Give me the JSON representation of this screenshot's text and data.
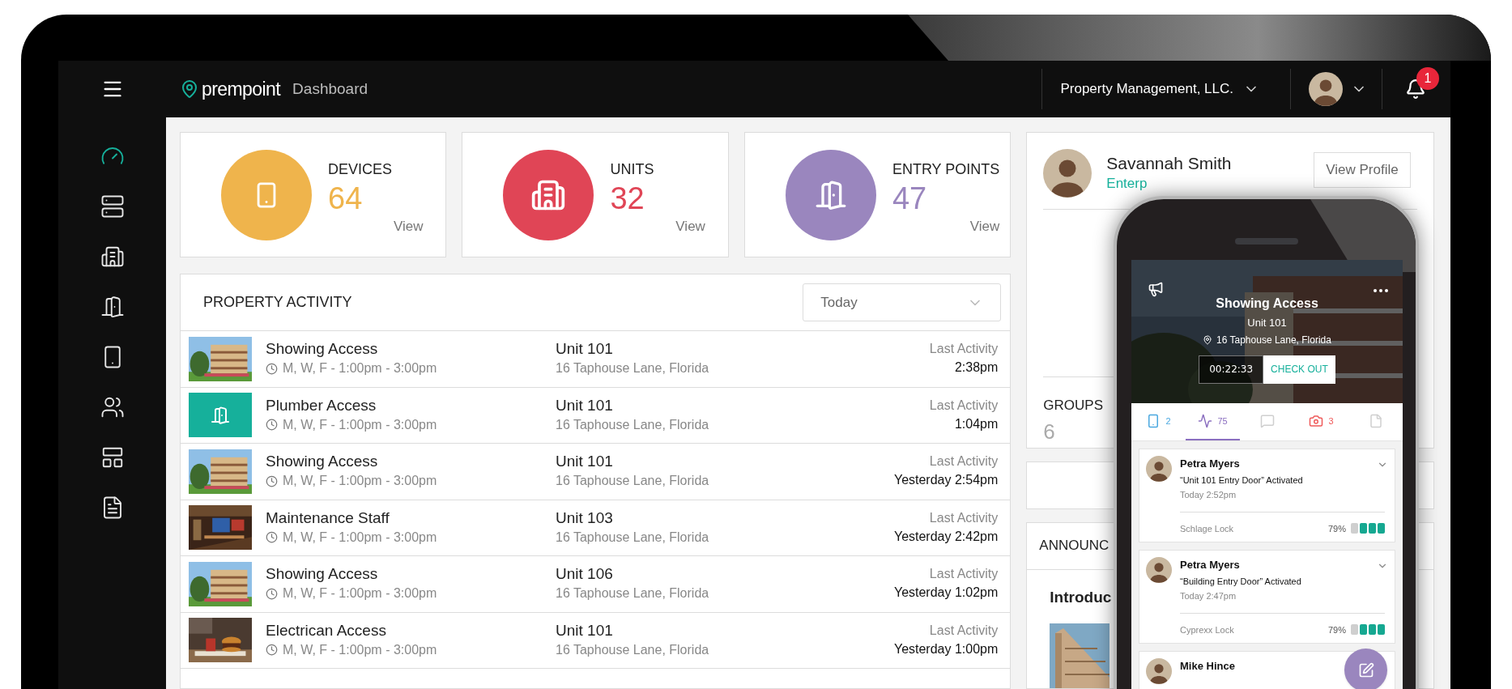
{
  "brand": {
    "logo": "prempoint",
    "page": "Dashboard"
  },
  "account": {
    "organization": "Property Management, LLC."
  },
  "notifications": {
    "count": "1"
  },
  "sidebar": {
    "items": [
      {
        "selected": true
      },
      {
        "selected": false
      },
      {
        "selected": false
      },
      {
        "selected": false
      },
      {
        "selected": false
      },
      {
        "selected": false
      },
      {
        "selected": false
      },
      {
        "selected": false
      }
    ]
  },
  "stats": [
    {
      "label": "DEVICES",
      "value": "64",
      "link": "View",
      "color": "#efb44c"
    },
    {
      "label": "UNITS",
      "value": "32",
      "link": "View",
      "color": "#e04556"
    },
    {
      "label": "ENTRY POINTS",
      "value": "47",
      "link": "View",
      "color": "#9a86be"
    }
  ],
  "activity": {
    "title": "PROPERTY ACTIVITY",
    "filter": "Today",
    "rows": [
      {
        "title": "Showing Access",
        "schedule": "M, W, F - 1:00pm - 3:00pm",
        "unit": "Unit 101",
        "address": "16 Taphouse Lane, Florida",
        "activity_label": "Last Activity",
        "activity_time": "2:38pm"
      },
      {
        "thumb": {
          "kind": "door"
        },
        "title": "Plumber Access",
        "schedule": "M, W, F - 1:00pm - 3:00pm",
        "unit": "Unit 101",
        "address": "16 Taphouse Lane, Florida",
        "activity_label": "Last Activity",
        "activity_time": "1:04pm"
      },
      {
        "title": "Showing Access",
        "schedule": "M, W, F - 1:00pm - 3:00pm",
        "unit": "Unit 101",
        "address": "16 Taphouse Lane, Florida",
        "activity_label": "Last Activity",
        "activity_time": "Yesterday 2:54pm"
      },
      {
        "title": "Maintenance Staff",
        "schedule": "M, W, F - 1:00pm - 3:00pm",
        "unit": "Unit 103",
        "address": "16 Taphouse Lane, Florida",
        "activity_label": "Last Activity",
        "activity_time": "Yesterday 2:42pm"
      },
      {
        "title": "Showing Access",
        "schedule": "M, W, F - 1:00pm - 3:00pm",
        "unit": "Unit 106",
        "address": "16 Taphouse Lane, Florida",
        "activity_label": "Last Activity",
        "activity_time": "Yesterday 1:02pm"
      },
      {
        "title": "Electrican Access",
        "schedule": "M, W, F - 1:00pm - 3:00pm",
        "unit": "Unit 101",
        "address": "16 Taphouse Lane, Florida",
        "activity_label": "Last Activity",
        "activity_time": "Yesterday 1:00pm"
      }
    ]
  },
  "profile": {
    "name": "Savannah Smith",
    "role": "Enterp",
    "button": "View Profile",
    "groups_label": "GROUPS",
    "groups_count": "6"
  },
  "announcements": {
    "title": "ANNOUNC",
    "headline": "Introduc"
  },
  "phone": {
    "title": "Showing Access",
    "unit": "Unit 101",
    "address": "16 Taphouse Lane, Florida",
    "timer": "00:22:33",
    "action": "CHECK OUT",
    "tabs": [
      {
        "count": "2",
        "selected": false
      },
      {
        "count": "75",
        "selected": true
      },
      {
        "selected": false
      },
      {
        "count": "3",
        "selected": false
      },
      {
        "selected": false
      }
    ],
    "feed": [
      {
        "name": "Petra Myers",
        "event": "“Unit 101 Entry Door” Activated",
        "time": "Today 2:52pm",
        "device": "Schlage Lock",
        "battery": "79%",
        "level": 0.79
      },
      {
        "name": "Petra Myers",
        "event": "“Building Entry Door” Activated",
        "time": "Today 2:47pm",
        "device": "Cyprexx Lock",
        "battery": "79%",
        "level": 0.79
      },
      {
        "name": "Mike Hince"
      }
    ]
  }
}
